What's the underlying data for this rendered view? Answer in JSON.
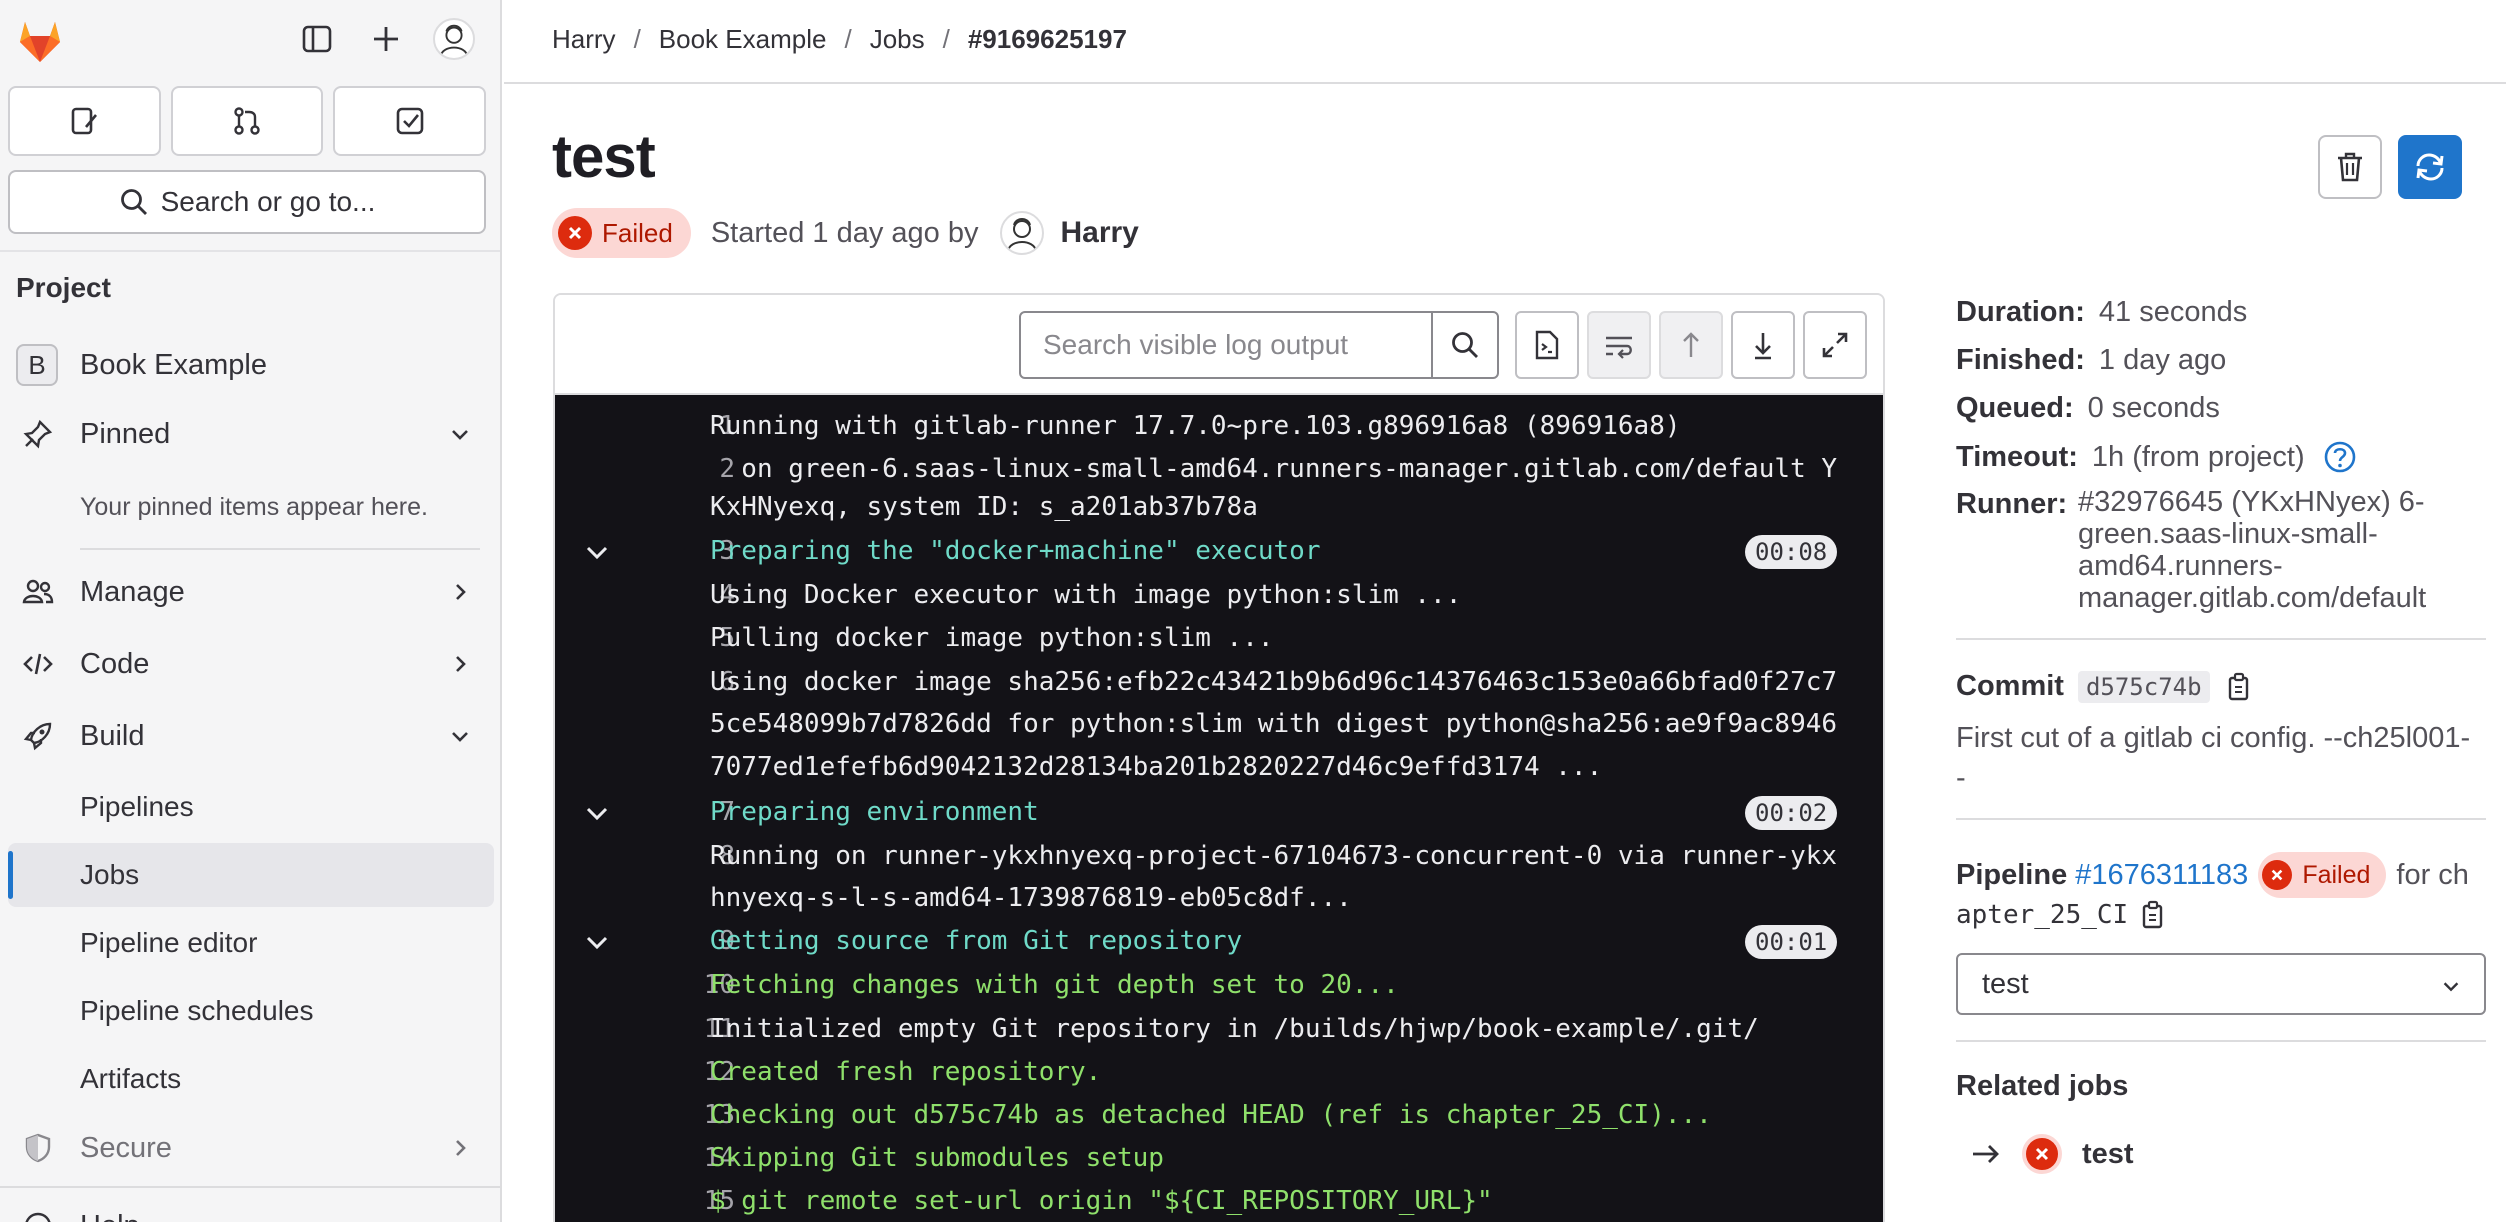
{
  "sidebar": {
    "search_label": "Search or go to...",
    "section_label": "Project",
    "project": {
      "initial": "B",
      "name": "Book Example"
    },
    "pinned": {
      "label": "Pinned",
      "note": "Your pinned items appear here."
    },
    "items": [
      {
        "label": "Manage",
        "icon": "users-icon"
      },
      {
        "label": "Code",
        "icon": "code-icon"
      },
      {
        "label": "Build",
        "icon": "rocket-icon"
      }
    ],
    "build_sub": [
      "Pipelines",
      "Jobs",
      "Pipeline editor",
      "Pipeline schedules",
      "Artifacts"
    ],
    "secure_label": "Secure",
    "help_label": "Help"
  },
  "breadcrumb": {
    "items": [
      "Harry",
      "Book Example",
      "Jobs",
      "#9169625197"
    ]
  },
  "job": {
    "title": "test",
    "status": "Failed",
    "started": "Started 1 day ago by",
    "author": "Harry"
  },
  "log": {
    "search_placeholder": "Search visible log output",
    "lines": [
      {
        "n": "1",
        "t": "Running with gitlab-runner 17.7.0~pre.103.g896916a8 (896916a8)",
        "k": "plain"
      },
      {
        "n": "2",
        "t": "  on green-6.saas-linux-small-amd64.runners-manager.gitlab.com/default Y",
        "k": "plain"
      },
      {
        "n": "",
        "t": "KxHNyexq, system ID: s_a201ab37b78a",
        "k": "plain"
      },
      {
        "n": "3",
        "t": "Preparing the \"docker+machine\" executor",
        "k": "sec",
        "dur": "00:08"
      },
      {
        "n": "4",
        "t": "Using Docker executor with image python:slim ...",
        "k": "plain"
      },
      {
        "n": "5",
        "t": "Pulling docker image python:slim ...",
        "k": "plain"
      },
      {
        "n": "6",
        "t": "Using docker image sha256:efb22c43421b9b6d96c14376463c153e0a66bfad0f27c7",
        "k": "plain"
      },
      {
        "n": "",
        "t": "5ce548099b7d7826dd for python:slim with digest python@sha256:ae9f9ac8946",
        "k": "plain"
      },
      {
        "n": "",
        "t": "7077ed1efefb6d9042132d28134ba201b2820227d46c9effd3174 ...",
        "k": "plain"
      },
      {
        "n": "7",
        "t": "Preparing environment",
        "k": "sec",
        "dur": "00:02"
      },
      {
        "n": "8",
        "t": "Running on runner-ykxhnyexq-project-67104673-concurrent-0 via runner-ykx",
        "k": "plain"
      },
      {
        "n": "",
        "t": "hnyexq-s-l-s-amd64-1739876819-eb05c8df...",
        "k": "plain"
      },
      {
        "n": "9",
        "t": "Getting source from Git repository",
        "k": "sec",
        "dur": "00:01"
      },
      {
        "n": "10",
        "t": "Fetching changes with git depth set to 20...",
        "k": "grn"
      },
      {
        "n": "11",
        "t": "Initialized empty Git repository in /builds/hjwp/book-example/.git/",
        "k": "plain"
      },
      {
        "n": "12",
        "t": "Created fresh repository.",
        "k": "grn"
      },
      {
        "n": "13",
        "t": "Checking out d575c74b as detached HEAD (ref is chapter_25_CI)...",
        "k": "grn"
      },
      {
        "n": "14",
        "t": "Skipping Git submodules setup",
        "k": "grn"
      },
      {
        "n": "15",
        "t": "$ git remote set-url origin \"${CI_REPOSITORY_URL}\"",
        "k": "grn"
      }
    ]
  },
  "details": {
    "duration_label": "Duration:",
    "duration": "41 seconds",
    "finished_label": "Finished:",
    "finished": "1 day ago",
    "queued_label": "Queued:",
    "queued": "0 seconds",
    "timeout_label": "Timeout:",
    "timeout": "1h (from project)",
    "runner_label": "Runner:",
    "runner": "#32976645 (YKxHNyex) 6-green.saas-linux-small-amd64.runners-manager.gitlab.com/default",
    "commit_label": "Commit",
    "commit_sha": "d575c74b",
    "commit_msg": "First cut of a gitlab ci config. --ch25l001--",
    "pipeline_label": "Pipeline",
    "pipeline_id": "#1676311183",
    "pipeline_status": "Failed",
    "pipeline_for": "for ch",
    "pipeline_ref": "apter_25_CI",
    "stage_select": "test",
    "related_title": "Related jobs",
    "related_job": "test"
  },
  "colors": {
    "accent": "#1f75cb",
    "failed": "#dd2b0e",
    "log_bg": "#131217",
    "section": "#6fdac8",
    "success_text": "#8fe06b"
  }
}
